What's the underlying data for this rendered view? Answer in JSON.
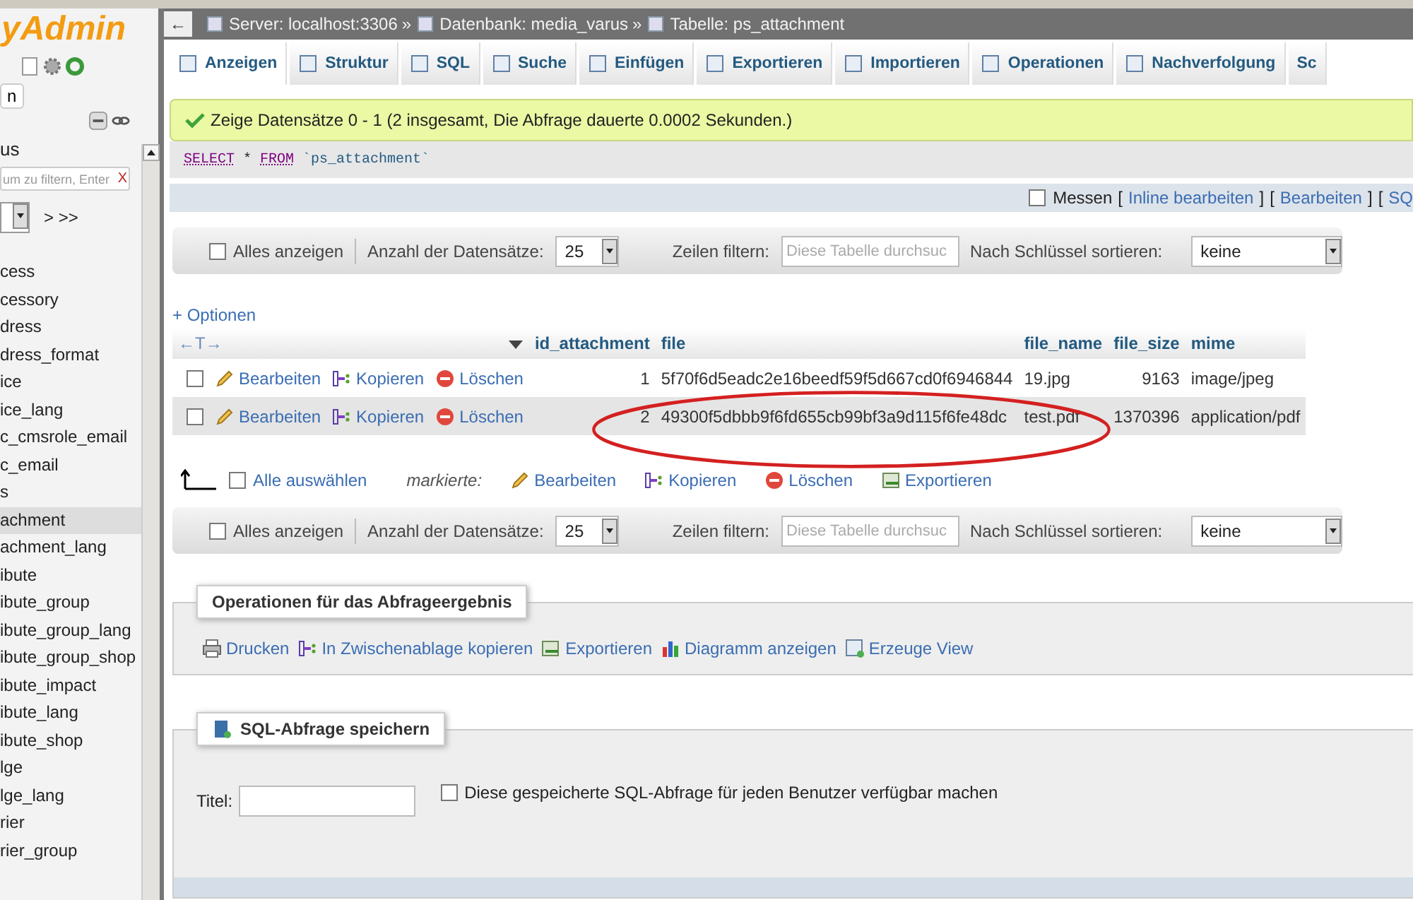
{
  "sidebar": {
    "logo": "yAdmin",
    "server_button": "n",
    "database": "us",
    "filter": {
      "placeholder": "um zu filtern, Enter",
      "clear": "X"
    },
    "pager": "> >>",
    "tables": [
      {
        "name": "cess",
        "selected": false
      },
      {
        "name": "cessory",
        "selected": false
      },
      {
        "name": "dress",
        "selected": false
      },
      {
        "name": "dress_format",
        "selected": false
      },
      {
        "name": "ice",
        "selected": false
      },
      {
        "name": "ice_lang",
        "selected": false
      },
      {
        "name": "c_cmsrole_email",
        "selected": false
      },
      {
        "name": "c_email",
        "selected": false
      },
      {
        "name": "s",
        "selected": false
      },
      {
        "name": "achment",
        "selected": true
      },
      {
        "name": "achment_lang",
        "selected": false
      },
      {
        "name": "ibute",
        "selected": false
      },
      {
        "name": "ibute_group",
        "selected": false
      },
      {
        "name": "ibute_group_lang",
        "selected": false
      },
      {
        "name": "ibute_group_shop",
        "selected": false
      },
      {
        "name": "ibute_impact",
        "selected": false
      },
      {
        "name": "ibute_lang",
        "selected": false
      },
      {
        "name": "ibute_shop",
        "selected": false
      },
      {
        "name": "lge",
        "selected": false
      },
      {
        "name": "lge_lang",
        "selected": false
      },
      {
        "name": "rier",
        "selected": false
      },
      {
        "name": "rier_group",
        "selected": false
      }
    ]
  },
  "breadcrumb": {
    "back": "←",
    "items": [
      "Server: localhost:3306",
      "Datenbank: media_varus",
      "Tabelle: ps_attachment"
    ],
    "separators": [
      "»",
      "»"
    ]
  },
  "tabs": [
    {
      "label": "Anzeigen",
      "selected": true
    },
    {
      "label": "Struktur",
      "selected": false
    },
    {
      "label": "SQL",
      "selected": false
    },
    {
      "label": "Suche",
      "selected": false
    },
    {
      "label": "Einfügen",
      "selected": false
    },
    {
      "label": "Exportieren",
      "selected": false
    },
    {
      "label": "Importieren",
      "selected": false
    },
    {
      "label": "Operationen",
      "selected": false
    },
    {
      "label": "Nachverfolgung",
      "selected": false
    },
    {
      "label": "Sc",
      "selected": false
    }
  ],
  "message": "Zeige Datensätze 0 - 1 (2 insgesamt, Die Abfrage dauerte 0.0002 Sekunden.)",
  "sql": [
    {
      "kind": "keyword",
      "text": "SELECT"
    },
    {
      "kind": "operator",
      "text": "*"
    },
    {
      "kind": "keyword",
      "text": "FROM"
    },
    {
      "kind": "identifier",
      "text": "`ps_attachment`"
    }
  ],
  "query_tools": {
    "measure": {
      "label": "Messen",
      "checked": false
    },
    "links": [
      {
        "before": "[",
        "label": "Inline bearbeiten",
        "after": "]"
      },
      {
        "before": "[",
        "label": "Bearbeiten",
        "after": "]"
      },
      {
        "before": "[",
        "label": "SQ"
      }
    ]
  },
  "navigation_bars": [
    {
      "show_all": {
        "label": "Alles anzeigen",
        "checked": false
      },
      "rows_label": "Anzahl der Datensätze:",
      "rows_value": "25",
      "filter_label": "Zeilen filtern:",
      "filter_placeholder": "Diese Tabelle durchsuc",
      "sort_label": "Nach Schlüssel sortieren:",
      "sort_value": "keine"
    },
    {
      "show_all": {
        "label": "Alles anzeigen",
        "checked": false
      },
      "rows_label": "Anzahl der Datensätze:",
      "rows_value": "25",
      "filter_label": "Zeilen filtern:",
      "filter_placeholder": "Diese Tabelle durchsuc",
      "sort_label": "Nach Schlüssel sortieren:",
      "sort_value": "keine"
    }
  ],
  "options_link": "+ Optionen",
  "table": {
    "resize_label": "←T→",
    "columns": [
      "id_attachment",
      "file",
      "file_name",
      "file_size",
      "mime"
    ],
    "rows": [
      {
        "checked": false,
        "actions": [
          "Bearbeiten",
          "Kopieren",
          "Löschen"
        ],
        "cells": [
          "1",
          "5f70f6d5eadc2e16beedf59f5d667cd0f6946844",
          "19.jpg",
          "9163",
          "image/jpeg"
        ]
      },
      {
        "checked": false,
        "actions": [
          "Bearbeiten",
          "Kopieren",
          "Löschen"
        ],
        "cells": [
          "2",
          "49300f5dbbb9f6fd655cb99bf3a9d115f6fe48dc",
          "test.pdf",
          "1370396",
          "application/pdf"
        ]
      }
    ]
  },
  "bulk": {
    "select_all": {
      "label": "Alle auswählen",
      "checked": false
    },
    "marked_label": "markierte:",
    "actions": [
      "Bearbeiten",
      "Kopieren",
      "Löschen",
      "Exportieren"
    ]
  },
  "result_operations": {
    "legend": "Operationen für das Abfrageergebnis",
    "actions": [
      "Drucken",
      "In Zwischenablage kopieren",
      "Exportieren",
      "Diagramm anzeigen",
      "Erzeuge View"
    ]
  },
  "bookmark": {
    "legend": "SQL-Abfrage speichern",
    "title_label": "Titel:",
    "share": {
      "label": "Diese gespeicherte SQL-Abfrage für jeden Benutzer verfügbar machen",
      "checked": false
    }
  }
}
